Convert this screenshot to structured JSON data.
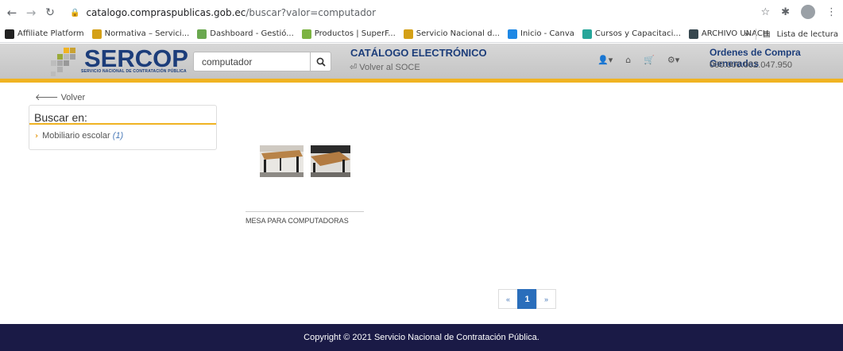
{
  "browser": {
    "url_host": "catalogo.compraspublicas.gob.ec",
    "url_path": "/buscar?valor=computador",
    "bookmarks": [
      {
        "label": "Affiliate Platform",
        "color": "#222"
      },
      {
        "label": "Normativa – Servici...",
        "color": "#d4a017"
      },
      {
        "label": "Dashboard - Gestió...",
        "color": "#6aa84f"
      },
      {
        "label": "Productos | SuperF...",
        "color": "#7cb342"
      },
      {
        "label": "Servicio Nacional d...",
        "color": "#d4a017"
      },
      {
        "label": "Inicio - Canva",
        "color": "#1e88e5"
      },
      {
        "label": "Cursos y Capacitaci...",
        "color": "#26a69a"
      },
      {
        "label": "ARCHIVO UNACH",
        "color": "#37474f"
      }
    ],
    "more_label": "»",
    "reading_list": "Lista de lectura"
  },
  "header": {
    "logo_text": "SERCOP",
    "logo_sub": "SERVICIO NACIONAL DE CONTRATACIÓN PÚBLICA",
    "search_value": "computador",
    "catalog_title": "CATÁLOGO ELECTRÓNICO",
    "back_soce": "Volver al SOCE",
    "orders_title": "Ordenes de Compra Generadas",
    "orders_value": "000.000.002.047.950"
  },
  "main": {
    "volver": "Volver",
    "panel_title": "Buscar en:",
    "category_label": "Mobiliario escolar",
    "category_count": "(1)",
    "product_name": "MESA PARA COMPUTADORAS"
  },
  "pagination": {
    "prev": "«",
    "current": "1",
    "next": "»"
  },
  "footer": {
    "copyright": "Copyright © 2021 Servicio Nacional de Contratación Pública."
  },
  "colors": {
    "brand_blue": "#1c3d7a",
    "accent_gold": "#f0b322",
    "footer_bg": "#1a1a46",
    "pager_active": "#2a6ebb"
  }
}
